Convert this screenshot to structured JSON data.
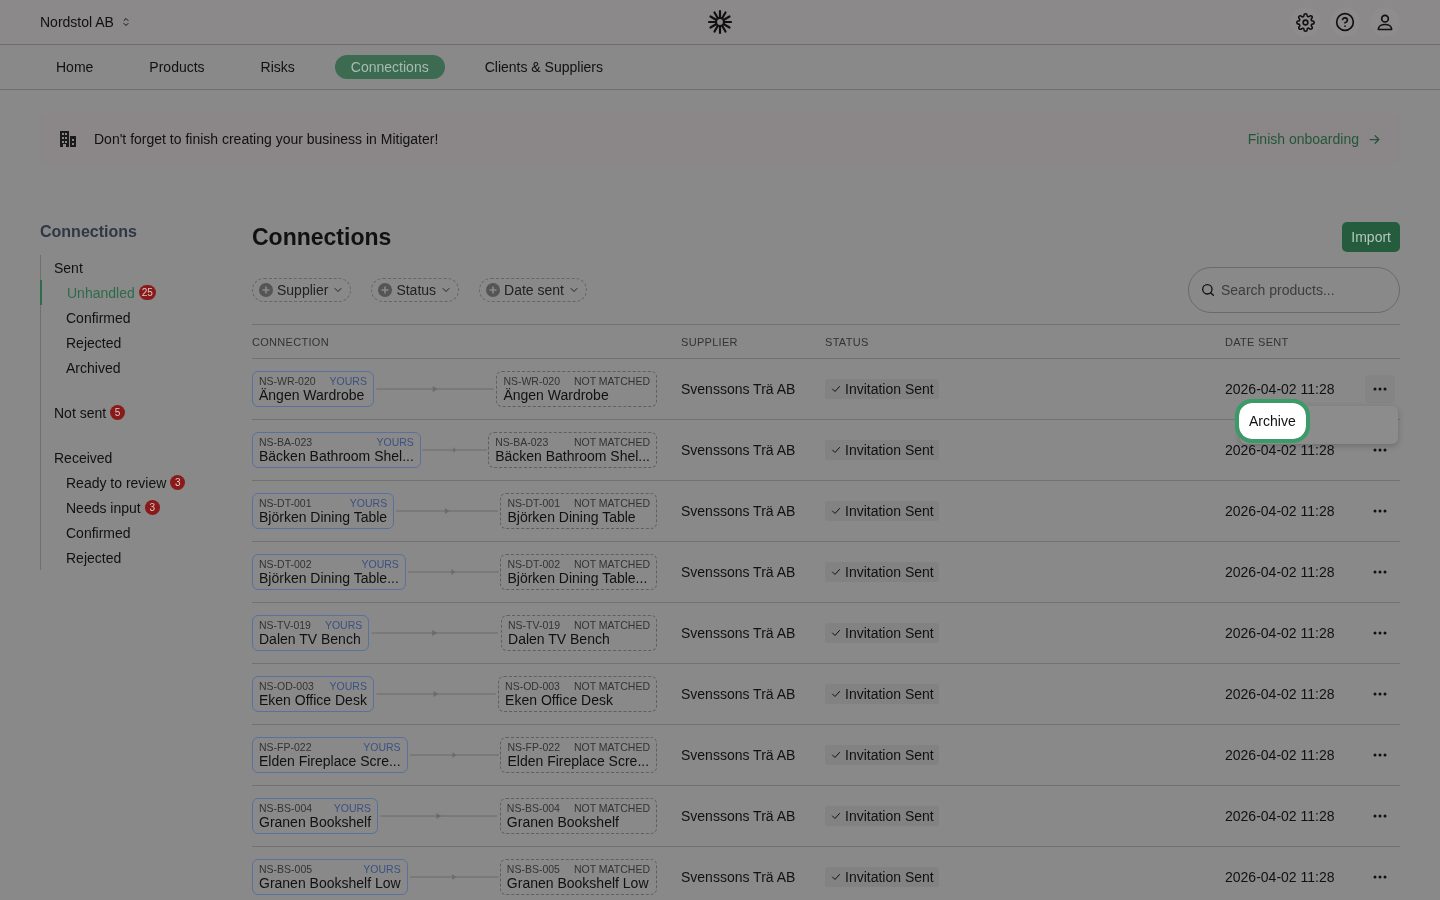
{
  "header": {
    "org": "Nordstol AB"
  },
  "nav": [
    {
      "label": "Home",
      "selected": false
    },
    {
      "label": "Products",
      "selected": false
    },
    {
      "label": "Risks",
      "selected": false
    },
    {
      "label": "Connections",
      "selected": true
    },
    {
      "label": "Clients & Suppliers",
      "selected": false
    }
  ],
  "banner": {
    "message": "Don't forget to finish creating your business in Mitigater!",
    "action": "Finish onboarding"
  },
  "sidebar": {
    "title": "Connections",
    "groups": [
      {
        "label": "Sent",
        "children": [
          {
            "label": "Unhandled",
            "selected": true,
            "badge": "25"
          },
          {
            "label": "Confirmed",
            "selected": false
          },
          {
            "label": "Rejected",
            "selected": false
          },
          {
            "label": "Archived",
            "selected": false
          }
        ]
      },
      {
        "label": "Not sent",
        "badge": "5"
      },
      {
        "label": "Received",
        "children": [
          {
            "label": "Ready to review",
            "selected": false,
            "badge": "3"
          },
          {
            "label": "Needs input",
            "selected": false,
            "badge": "3"
          },
          {
            "label": "Confirmed",
            "selected": false
          },
          {
            "label": "Rejected",
            "selected": false
          }
        ]
      }
    ]
  },
  "main": {
    "title": "Connections",
    "import_button": "Import",
    "filters": [
      "Supplier",
      "Status",
      "Date sent"
    ],
    "search": {
      "placeholder": "Search products..."
    },
    "columns": [
      "CONNECTION",
      "SUPPLIER",
      "STATUS",
      "DATE SENT"
    ],
    "rows": [
      {
        "code": "NS-WR-020",
        "name": "Ängen Wardrobe",
        "tag": "YOURS",
        "match_code": "NS-WR-020",
        "match_name": "Ängen Wardrobe",
        "match_tag": "NOT MATCHED",
        "supplier": "Svenssons Trä AB",
        "status": "Invitation Sent",
        "date_sent": "2026-04-02 11:28",
        "menu": {
          "items": [
            {
              "label": "Archive",
              "selected": true
            }
          ]
        }
      },
      {
        "code": "NS-BA-023",
        "name": "Bäcken Bathroom Shel...",
        "tag": "YOURS",
        "match_code": "NS-BA-023",
        "match_name": "Bäcken Bathroom Shel...",
        "match_tag": "NOT MATCHED",
        "supplier": "Svenssons Trä AB",
        "status": "Invitation Sent",
        "date_sent": "2026-04-02 11:28"
      },
      {
        "code": "NS-DT-001",
        "name": "Björken Dining Table",
        "tag": "YOURS",
        "match_code": "NS-DT-001",
        "match_name": "Björken Dining Table",
        "match_tag": "NOT MATCHED",
        "supplier": "Svenssons Trä AB",
        "status": "Invitation Sent",
        "date_sent": "2026-04-02 11:28"
      },
      {
        "code": "NS-DT-002",
        "name": "Björken Dining Table...",
        "tag": "YOURS",
        "match_code": "NS-DT-002",
        "match_name": "Björken Dining Table...",
        "match_tag": "NOT MATCHED",
        "supplier": "Svenssons Trä AB",
        "status": "Invitation Sent",
        "date_sent": "2026-04-02 11:28"
      },
      {
        "code": "NS-TV-019",
        "name": "Dalen TV Bench",
        "tag": "YOURS",
        "match_code": "NS-TV-019",
        "match_name": "Dalen TV Bench",
        "match_tag": "NOT MATCHED",
        "supplier": "Svenssons Trä AB",
        "status": "Invitation Sent",
        "date_sent": "2026-04-02 11:28"
      },
      {
        "code": "NS-OD-003",
        "name": "Eken Office Desk",
        "tag": "YOURS",
        "match_code": "NS-OD-003",
        "match_name": "Eken Office Desk",
        "match_tag": "NOT MATCHED",
        "supplier": "Svenssons Trä AB",
        "status": "Invitation Sent",
        "date_sent": "2026-04-02 11:28"
      },
      {
        "code": "NS-FP-022",
        "name": "Elden Fireplace Scre...",
        "tag": "YOURS",
        "match_code": "NS-FP-022",
        "match_name": "Elden Fireplace Scre...",
        "match_tag": "NOT MATCHED",
        "supplier": "Svenssons Trä AB",
        "status": "Invitation Sent",
        "date_sent": "2026-04-02 11:28"
      },
      {
        "code": "NS-BS-004",
        "name": "Granen Bookshelf",
        "tag": "YOURS",
        "match_code": "NS-BS-004",
        "match_name": "Granen Bookshelf",
        "match_tag": "NOT MATCHED",
        "supplier": "Svenssons Trä AB",
        "status": "Invitation Sent",
        "date_sent": "2026-04-02 11:28"
      },
      {
        "code": "NS-BS-005",
        "name": "Granen Bookshelf Low",
        "tag": "YOURS",
        "match_code": "NS-BS-005",
        "match_name": "Granen Bookshelf Low",
        "match_tag": "NOT MATCHED",
        "supplier": "Svenssons Trä AB",
        "status": "Invitation Sent",
        "date_sent": "2026-04-02 11:28"
      }
    ]
  }
}
